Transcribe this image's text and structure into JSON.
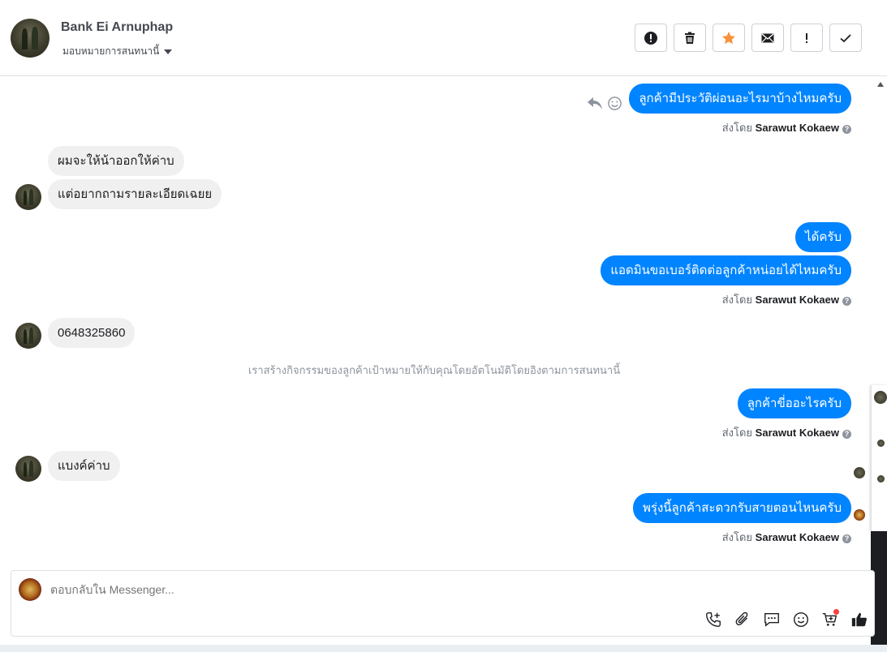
{
  "header": {
    "name": "Bank Ei Arnuphap",
    "assign_label": "มอบหมายการสนทนานี้",
    "buttons": [
      {
        "icon": "alert-circle-icon",
        "name": "mark-spam-button"
      },
      {
        "icon": "trash-icon",
        "name": "delete-button"
      },
      {
        "icon": "star-icon",
        "name": "star-button"
      },
      {
        "icon": "envelope-icon",
        "name": "mark-unread-button"
      },
      {
        "icon": "exclamation-icon",
        "name": "follow-up-button"
      },
      {
        "icon": "check-icon",
        "name": "mark-done-button"
      }
    ],
    "star_color": "#f7923b"
  },
  "messages": {
    "m1": "ลูกค้ามีประวัติผ่อนอะไรมาบ้างไหมครับ",
    "m2": "ผมจะให้น้าออกให้ค่าบ",
    "m3": "แต่อยากถามรายละเอียดเฉยย",
    "m4": "ได้ครับ",
    "m5": "แอดมินขอเบอร์ติดต่อลูกค้าหน่อยได้ไหมครับ",
    "m6": "0648325860",
    "m7": "ลูกค้าขี่ออะไรครับ",
    "m8": "แบงค์ค่าบ",
    "m9": "พรุ่งนี้ลูกค้าสะดวกรับสายตอนไหนครับ"
  },
  "sent_by_prefix": "ส่งโดย",
  "sender": "Sarawut Kokaew",
  "system_note": "เราสร้างกิจกรรมของลูกค้าเป้าหมายให้กับคุณโดยอัตโนมัติโดยอิงตามการสนทนานี้",
  "composer": {
    "placeholder": "ตอบกลับใน Messenger..."
  },
  "colors": {
    "outgoing_bubble": "#0084ff",
    "incoming_bubble": "#f1f0f0"
  }
}
